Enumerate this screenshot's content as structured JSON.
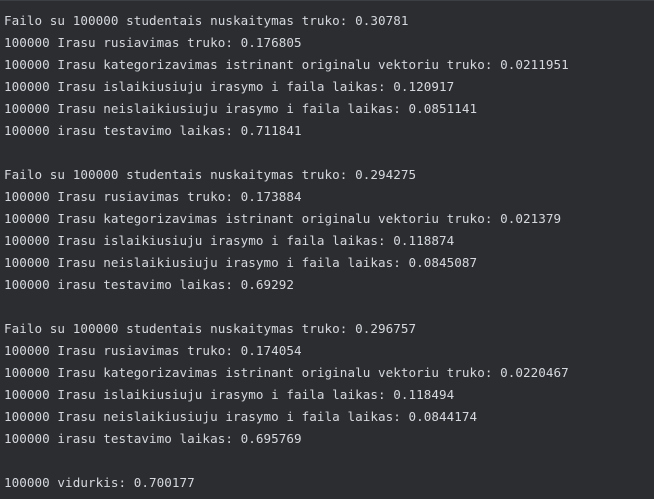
{
  "console": {
    "lines": [
      "Failo su 100000 studentais nuskaitymas truko: 0.30781",
      "100000 Irasu rusiavimas truko: 0.176805",
      "100000 Irasu kategorizavimas istrinant originalu vektoriu truko: 0.0211951",
      "100000 Irasu islaikiusiuju irasymo i faila laikas: 0.120917",
      "100000 Irasu neislaikiusiuju irasymo i faila laikas: 0.0851141",
      "100000 irasu testavimo laikas: 0.711841",
      "",
      "Failo su 100000 studentais nuskaitymas truko: 0.294275",
      "100000 Irasu rusiavimas truko: 0.173884",
      "100000 Irasu kategorizavimas istrinant originalu vektoriu truko: 0.021379",
      "100000 Irasu islaikiusiuju irasymo i faila laikas: 0.118874",
      "100000 Irasu neislaikiusiuju irasymo i faila laikas: 0.0845087",
      "100000 irasu testavimo laikas: 0.69292",
      "",
      "Failo su 100000 studentais nuskaitymas truko: 0.296757",
      "100000 Irasu rusiavimas truko: 0.174054",
      "100000 Irasu kategorizavimas istrinant originalu vektoriu truko: 0.0220467",
      "100000 Irasu islaikiusiuju irasymo i faila laikas: 0.118494",
      "100000 Irasu neislaikiusiuju irasymo i faila laikas: 0.0844174",
      "100000 irasu testavimo laikas: 0.695769",
      "",
      "100000 vidurkis: 0.700177"
    ]
  },
  "colors": {
    "background": "#2b2d30",
    "text": "#d5d8de"
  }
}
